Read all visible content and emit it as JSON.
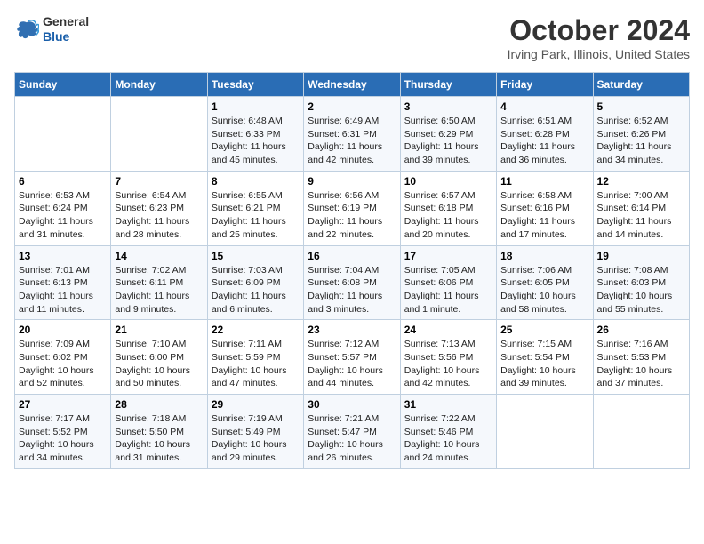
{
  "logo": {
    "line1": "General",
    "line2": "Blue"
  },
  "title": "October 2024",
  "subtitle": "Irving Park, Illinois, United States",
  "days_of_week": [
    "Sunday",
    "Monday",
    "Tuesday",
    "Wednesday",
    "Thursday",
    "Friday",
    "Saturday"
  ],
  "weeks": [
    [
      {
        "num": "",
        "info": ""
      },
      {
        "num": "",
        "info": ""
      },
      {
        "num": "1",
        "info": "Sunrise: 6:48 AM\nSunset: 6:33 PM\nDaylight: 11 hours and 45 minutes."
      },
      {
        "num": "2",
        "info": "Sunrise: 6:49 AM\nSunset: 6:31 PM\nDaylight: 11 hours and 42 minutes."
      },
      {
        "num": "3",
        "info": "Sunrise: 6:50 AM\nSunset: 6:29 PM\nDaylight: 11 hours and 39 minutes."
      },
      {
        "num": "4",
        "info": "Sunrise: 6:51 AM\nSunset: 6:28 PM\nDaylight: 11 hours and 36 minutes."
      },
      {
        "num": "5",
        "info": "Sunrise: 6:52 AM\nSunset: 6:26 PM\nDaylight: 11 hours and 34 minutes."
      }
    ],
    [
      {
        "num": "6",
        "info": "Sunrise: 6:53 AM\nSunset: 6:24 PM\nDaylight: 11 hours and 31 minutes."
      },
      {
        "num": "7",
        "info": "Sunrise: 6:54 AM\nSunset: 6:23 PM\nDaylight: 11 hours and 28 minutes."
      },
      {
        "num": "8",
        "info": "Sunrise: 6:55 AM\nSunset: 6:21 PM\nDaylight: 11 hours and 25 minutes."
      },
      {
        "num": "9",
        "info": "Sunrise: 6:56 AM\nSunset: 6:19 PM\nDaylight: 11 hours and 22 minutes."
      },
      {
        "num": "10",
        "info": "Sunrise: 6:57 AM\nSunset: 6:18 PM\nDaylight: 11 hours and 20 minutes."
      },
      {
        "num": "11",
        "info": "Sunrise: 6:58 AM\nSunset: 6:16 PM\nDaylight: 11 hours and 17 minutes."
      },
      {
        "num": "12",
        "info": "Sunrise: 7:00 AM\nSunset: 6:14 PM\nDaylight: 11 hours and 14 minutes."
      }
    ],
    [
      {
        "num": "13",
        "info": "Sunrise: 7:01 AM\nSunset: 6:13 PM\nDaylight: 11 hours and 11 minutes."
      },
      {
        "num": "14",
        "info": "Sunrise: 7:02 AM\nSunset: 6:11 PM\nDaylight: 11 hours and 9 minutes."
      },
      {
        "num": "15",
        "info": "Sunrise: 7:03 AM\nSunset: 6:09 PM\nDaylight: 11 hours and 6 minutes."
      },
      {
        "num": "16",
        "info": "Sunrise: 7:04 AM\nSunset: 6:08 PM\nDaylight: 11 hours and 3 minutes."
      },
      {
        "num": "17",
        "info": "Sunrise: 7:05 AM\nSunset: 6:06 PM\nDaylight: 11 hours and 1 minute."
      },
      {
        "num": "18",
        "info": "Sunrise: 7:06 AM\nSunset: 6:05 PM\nDaylight: 10 hours and 58 minutes."
      },
      {
        "num": "19",
        "info": "Sunrise: 7:08 AM\nSunset: 6:03 PM\nDaylight: 10 hours and 55 minutes."
      }
    ],
    [
      {
        "num": "20",
        "info": "Sunrise: 7:09 AM\nSunset: 6:02 PM\nDaylight: 10 hours and 52 minutes."
      },
      {
        "num": "21",
        "info": "Sunrise: 7:10 AM\nSunset: 6:00 PM\nDaylight: 10 hours and 50 minutes."
      },
      {
        "num": "22",
        "info": "Sunrise: 7:11 AM\nSunset: 5:59 PM\nDaylight: 10 hours and 47 minutes."
      },
      {
        "num": "23",
        "info": "Sunrise: 7:12 AM\nSunset: 5:57 PM\nDaylight: 10 hours and 44 minutes."
      },
      {
        "num": "24",
        "info": "Sunrise: 7:13 AM\nSunset: 5:56 PM\nDaylight: 10 hours and 42 minutes."
      },
      {
        "num": "25",
        "info": "Sunrise: 7:15 AM\nSunset: 5:54 PM\nDaylight: 10 hours and 39 minutes."
      },
      {
        "num": "26",
        "info": "Sunrise: 7:16 AM\nSunset: 5:53 PM\nDaylight: 10 hours and 37 minutes."
      }
    ],
    [
      {
        "num": "27",
        "info": "Sunrise: 7:17 AM\nSunset: 5:52 PM\nDaylight: 10 hours and 34 minutes."
      },
      {
        "num": "28",
        "info": "Sunrise: 7:18 AM\nSunset: 5:50 PM\nDaylight: 10 hours and 31 minutes."
      },
      {
        "num": "29",
        "info": "Sunrise: 7:19 AM\nSunset: 5:49 PM\nDaylight: 10 hours and 29 minutes."
      },
      {
        "num": "30",
        "info": "Sunrise: 7:21 AM\nSunset: 5:47 PM\nDaylight: 10 hours and 26 minutes."
      },
      {
        "num": "31",
        "info": "Sunrise: 7:22 AM\nSunset: 5:46 PM\nDaylight: 10 hours and 24 minutes."
      },
      {
        "num": "",
        "info": ""
      },
      {
        "num": "",
        "info": ""
      }
    ]
  ]
}
